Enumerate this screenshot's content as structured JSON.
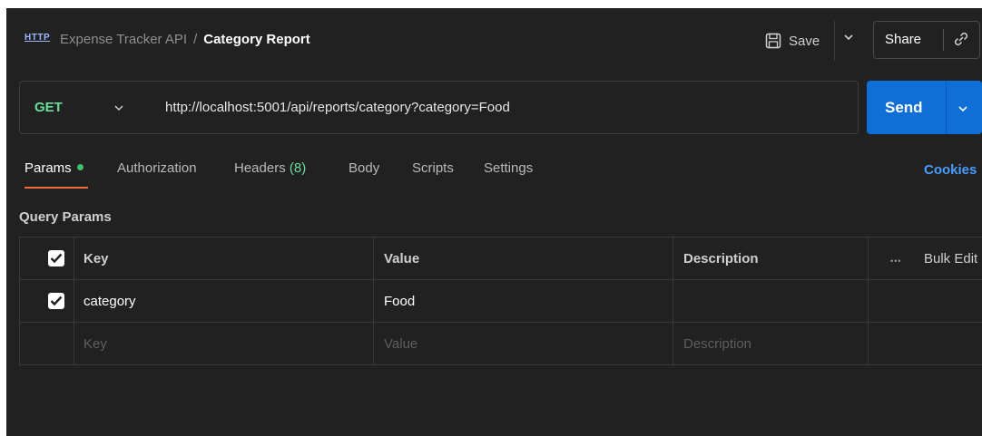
{
  "header": {
    "icon": "http-icon",
    "icon_text": "HTTP",
    "breadcrumb_parent": "Expense Tracker API",
    "breadcrumb_separator": "/",
    "breadcrumb_current": "Category Report",
    "save_label": "Save",
    "share_label": "Share"
  },
  "request": {
    "method": "GET",
    "url": "http://localhost:5001/api/reports/category?category=Food",
    "send_label": "Send"
  },
  "tabs": [
    {
      "label": "Params",
      "active": true,
      "has_indicator": true
    },
    {
      "label": "Authorization"
    },
    {
      "label": "Headers",
      "count": "(8)"
    },
    {
      "label": "Body"
    },
    {
      "label": "Scripts"
    },
    {
      "label": "Settings"
    }
  ],
  "cookies_label": "Cookies",
  "query_params": {
    "title": "Query Params",
    "columns": {
      "key": "Key",
      "value": "Value",
      "description": "Description",
      "bulk_edit": "Bulk Edit"
    },
    "rows": [
      {
        "checked": true,
        "key": "category",
        "value": "Food",
        "description": ""
      }
    ],
    "placeholders": {
      "key": "Key",
      "value": "Value",
      "description": "Description"
    }
  },
  "colors": {
    "background": "#212121",
    "method_green": "#6bdd9a",
    "send_blue": "#0f6fd6",
    "active_tab_underline": "#f26b3a",
    "link_blue": "#4b9cff"
  }
}
